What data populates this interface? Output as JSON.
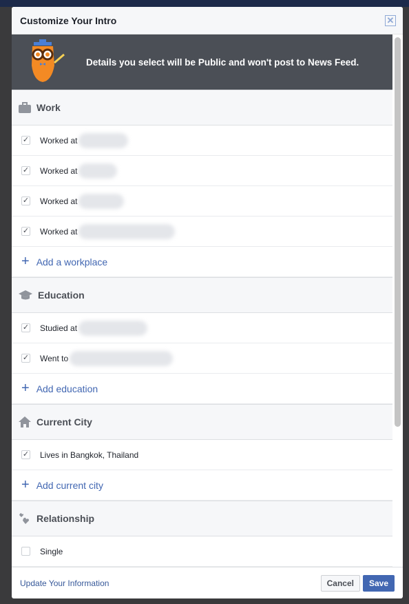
{
  "dialog": {
    "title": "Customize Your Intro"
  },
  "banner": {
    "text_before": "Details you select will be ",
    "text_bold": "Public",
    "text_after": " and won't post to News Feed."
  },
  "sections": {
    "work": {
      "title": "Work",
      "items": [
        {
          "label": "Worked at",
          "checked": true
        },
        {
          "label": "Worked at",
          "checked": true
        },
        {
          "label": "Worked at",
          "checked": true
        },
        {
          "label": "Worked at",
          "checked": true
        }
      ],
      "add": "Add a workplace"
    },
    "education": {
      "title": "Education",
      "items": [
        {
          "label": "Studied at",
          "checked": true
        },
        {
          "label": "Went to",
          "checked": true
        }
      ],
      "add": "Add education"
    },
    "city": {
      "title": "Current City",
      "items": [
        {
          "label": "Lives in Bangkok, Thailand",
          "checked": true
        }
      ],
      "add": "Add current city"
    },
    "relationship": {
      "title": "Relationship",
      "items": [
        {
          "label": "Single",
          "checked": false
        }
      ]
    }
  },
  "footer": {
    "update_link": "Update Your Information",
    "cancel": "Cancel",
    "save": "Save"
  },
  "colors": {
    "accent": "#4267b2",
    "banner": "#4b4f56"
  }
}
